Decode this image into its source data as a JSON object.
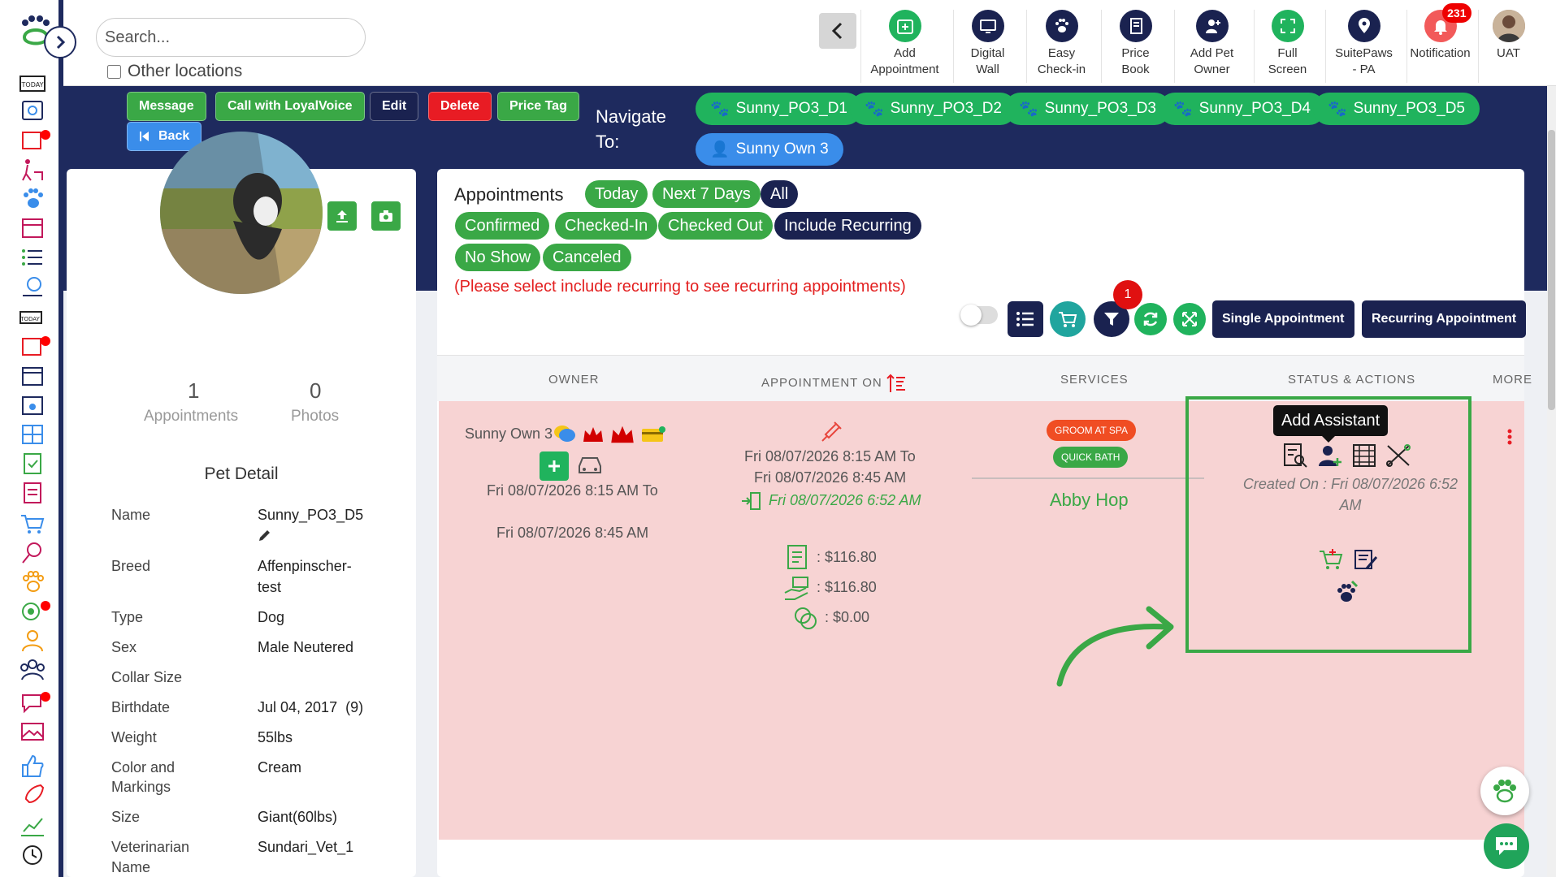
{
  "search": {
    "placeholder": "Search..."
  },
  "other_locations_label": "Other locations",
  "toolbar": [
    {
      "label": "Add Appointment",
      "icon": "calendar-add-icon"
    },
    {
      "label": "Digital Wall",
      "icon": "monitor-icon"
    },
    {
      "label": "Easy Check-in",
      "icon": "paw-icon"
    },
    {
      "label": "Price Book",
      "icon": "book-icon"
    },
    {
      "label": "Add Pet Owner",
      "icon": "add-user-icon"
    },
    {
      "label": "Full Screen",
      "icon": "fullscreen-icon"
    },
    {
      "label": "SuitePaws - PA",
      "icon": "location-pin-icon"
    },
    {
      "label": "Notification",
      "icon": "bell-icon",
      "badge": "231"
    },
    {
      "label": "UAT",
      "icon": "avatar-icon"
    }
  ],
  "actions": {
    "message": "Message",
    "call": "Call with LoyalVoice",
    "edit": "Edit",
    "delete": "Delete",
    "price_tag": "Price Tag",
    "back": "Back"
  },
  "navigate_to": "Navigate To:",
  "pets": [
    "Sunny_PO3_D1",
    "Sunny_PO3_D2",
    "Sunny_PO3_D3",
    "Sunny_PO3_D4",
    "Sunny_PO3_D5"
  ],
  "owner_pill": "Sunny Own 3",
  "stats": {
    "appointments_count": "1",
    "appointments_label": "Appointments",
    "photos_count": "0",
    "photos_label": "Photos"
  },
  "pet_detail": {
    "title": "Pet Detail",
    "rows": [
      {
        "label": "Name",
        "value": "Sunny_PO3_D5"
      },
      {
        "label": "Breed",
        "value": "Affenpinscher-"
      },
      {
        "label": "",
        "value": "test"
      },
      {
        "label": "Type",
        "value": "Dog"
      },
      {
        "label": "Sex",
        "value": "Male Neutered"
      },
      {
        "label": "Collar Size",
        "value": ""
      },
      {
        "label": "Birthdate",
        "value": "Jul 04, 2017  (9)"
      },
      {
        "label": "Weight",
        "value": "55lbs"
      },
      {
        "label": "Color and",
        "value": "Cream"
      },
      {
        "label": "Markings",
        "value": ""
      },
      {
        "label": "Size",
        "value": "Giant(60lbs)"
      },
      {
        "label": "Veterinarian",
        "value": "Sundari_Vet_1"
      },
      {
        "label": "Name",
        "value": ""
      }
    ]
  },
  "appointments": {
    "title": "Appointments",
    "filters_row1": [
      "Today",
      "Next 7 Days",
      "All"
    ],
    "filters_row2": [
      "Confirmed",
      "Checked-In",
      "Checked Out",
      "Include Recurring"
    ],
    "filters_row3": [
      "No Show",
      "Canceled"
    ],
    "note": "(Please select include recurring to see recurring appointments)",
    "filter_badge": "1",
    "single_btn": "Single Appointment",
    "recurring_btn": "Recurring Appointment",
    "columns": [
      "OWNER",
      "APPOINTMENT ON",
      "SERVICES",
      "STATUS & ACTIONS",
      "MORE"
    ],
    "row": {
      "owner_name": "Sunny Own 3",
      "owner_time1": "Fri 08/07/2026 8:15 AM To",
      "owner_time2": "Fri 08/07/2026 8:45 AM",
      "appt_time1": "Fri 08/07/2026 8:15 AM To",
      "appt_time2": "Fri 08/07/2026 8:45 AM",
      "checkin_time": "Fri 08/07/2026 6:52 AM",
      "amount1": ": $116.80",
      "amount2": ": $116.80",
      "amount3": ": $0.00",
      "service1": "GROOM AT SPA",
      "service2": "QUICK BATH",
      "staff": "Abby Hop",
      "tooltip": "Add Assistant",
      "created_on": "Created On : Fri 08/07/2026 6:52",
      "created_on2": "AM"
    }
  },
  "colors": {
    "navy": "#1e2a5e",
    "green": "#3aa846",
    "red": "#e81c24",
    "row_bg": "#f7d3d3"
  }
}
